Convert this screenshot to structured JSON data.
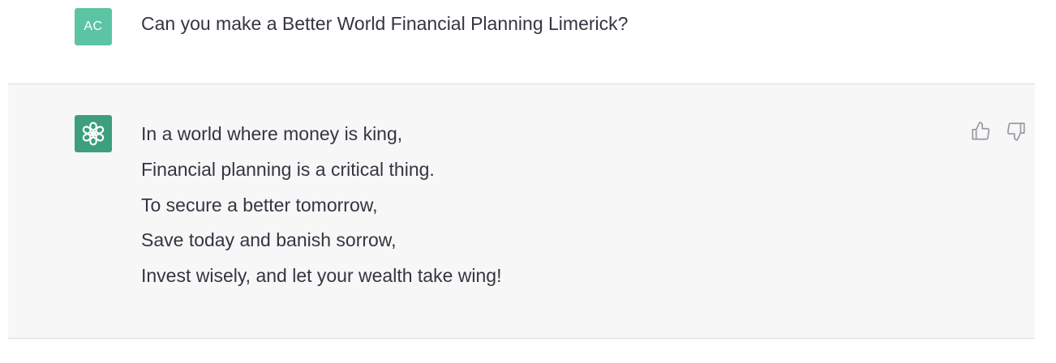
{
  "user_message": {
    "avatar_initials": "AC",
    "avatar_color": "#5cc4a2",
    "text": "Can you make a Better World Financial Planning Limerick?"
  },
  "assistant_message": {
    "avatar_icon": "openai-logo-icon",
    "avatar_color": "#3d9f7c",
    "lines": [
      "In a world where money is king,",
      "Financial planning is a critical thing.",
      "To secure a better tomorrow,",
      "Save today and banish sorrow,",
      "Invest wisely, and let your wealth take wing!"
    ],
    "actions": {
      "thumbs_up_icon": "thumbs-up-icon",
      "thumbs_down_icon": "thumbs-down-icon"
    }
  }
}
